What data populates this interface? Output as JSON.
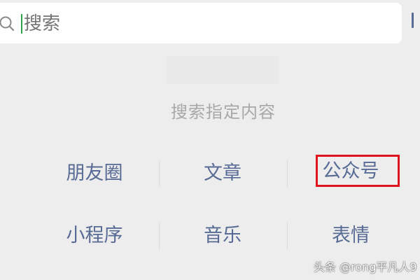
{
  "search": {
    "placeholder": "搜索"
  },
  "section": {
    "title": "搜索指定内容"
  },
  "categories": [
    {
      "label": "朋友圈"
    },
    {
      "label": "文章"
    },
    {
      "label": "公众号"
    },
    {
      "label": "小程序"
    },
    {
      "label": "音乐"
    },
    {
      "label": "表情"
    }
  ],
  "watermark": {
    "text": "头条 @rong平凡人9"
  },
  "colors": {
    "background": "#ededed",
    "link": "#576b95",
    "highlight": "#e0141e",
    "cursor": "#2ea44f"
  },
  "highlighted_item": "公众号"
}
